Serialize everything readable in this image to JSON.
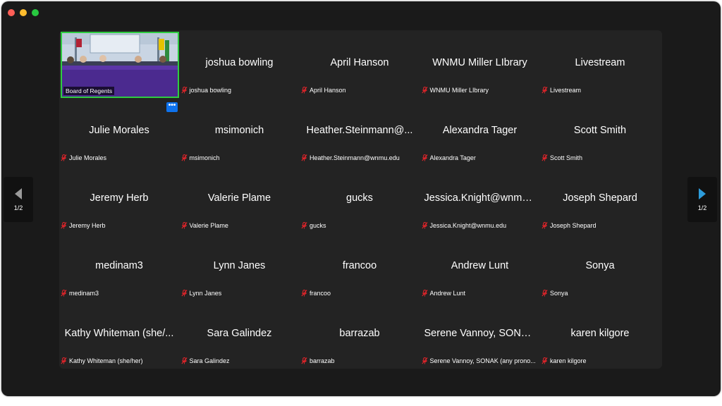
{
  "window": {
    "controls": [
      "close",
      "minimize",
      "zoom"
    ]
  },
  "gallery": {
    "video_tile": {
      "label": "Board of Regents"
    },
    "more_button": {
      "label": "•••"
    },
    "participants": [
      {
        "name": "joshua bowling",
        "label": "joshua bowling"
      },
      {
        "name": "April Hanson",
        "label": "April Hanson"
      },
      {
        "name": "WNMU Miller LIbrary",
        "label": "WNMU Miller LIbrary"
      },
      {
        "name": "Livestream",
        "label": "Livestream"
      },
      {
        "name": "Julie Morales",
        "label": "Julie Morales"
      },
      {
        "name": "msimonich",
        "label": "msimonich"
      },
      {
        "name": "Heather.Steinmann@...",
        "label": "Heather.Steinmann@wnmu.edu"
      },
      {
        "name": "Alexandra Tager",
        "label": "Alexandra Tager"
      },
      {
        "name": "Scott Smith",
        "label": "Scott Smith"
      },
      {
        "name": "Jeremy Herb",
        "label": "Jeremy Herb"
      },
      {
        "name": "Valerie Plame",
        "label": "Valerie Plame"
      },
      {
        "name": "gucks",
        "label": "gucks"
      },
      {
        "name": "Jessica.Knight@wnmu...",
        "label": "Jessica.Knight@wnmu.edu"
      },
      {
        "name": "Joseph Shepard",
        "label": "Joseph Shepard"
      },
      {
        "name": "medinam3",
        "label": "medinam3"
      },
      {
        "name": "Lynn Janes",
        "label": "Lynn Janes"
      },
      {
        "name": "francoo",
        "label": "francoo"
      },
      {
        "name": "Andrew Lunt",
        "label": "Andrew Lunt"
      },
      {
        "name": "Sonya",
        "label": "Sonya"
      },
      {
        "name": "Kathy Whiteman (she/...",
        "label": "Kathy Whiteman (she/her)"
      },
      {
        "name": "Sara Galindez",
        "label": "Sara Galindez"
      },
      {
        "name": "barrazab",
        "label": "barrazab"
      },
      {
        "name": "Serene Vannoy, SONA...",
        "label": "Serene Vannoy, SONAK (any prono..."
      },
      {
        "name": "karen kilgore",
        "label": "karen kilgore"
      }
    ]
  },
  "pagination": {
    "prev": {
      "page": "1/2",
      "icon": "triangle-left-icon"
    },
    "next": {
      "page": "1/2",
      "icon": "triangle-right-icon"
    }
  },
  "colors": {
    "active_speaker_border": "#2ecc40",
    "next_arrow": "#2d9cdb",
    "muted_mic": "#e0242a"
  }
}
